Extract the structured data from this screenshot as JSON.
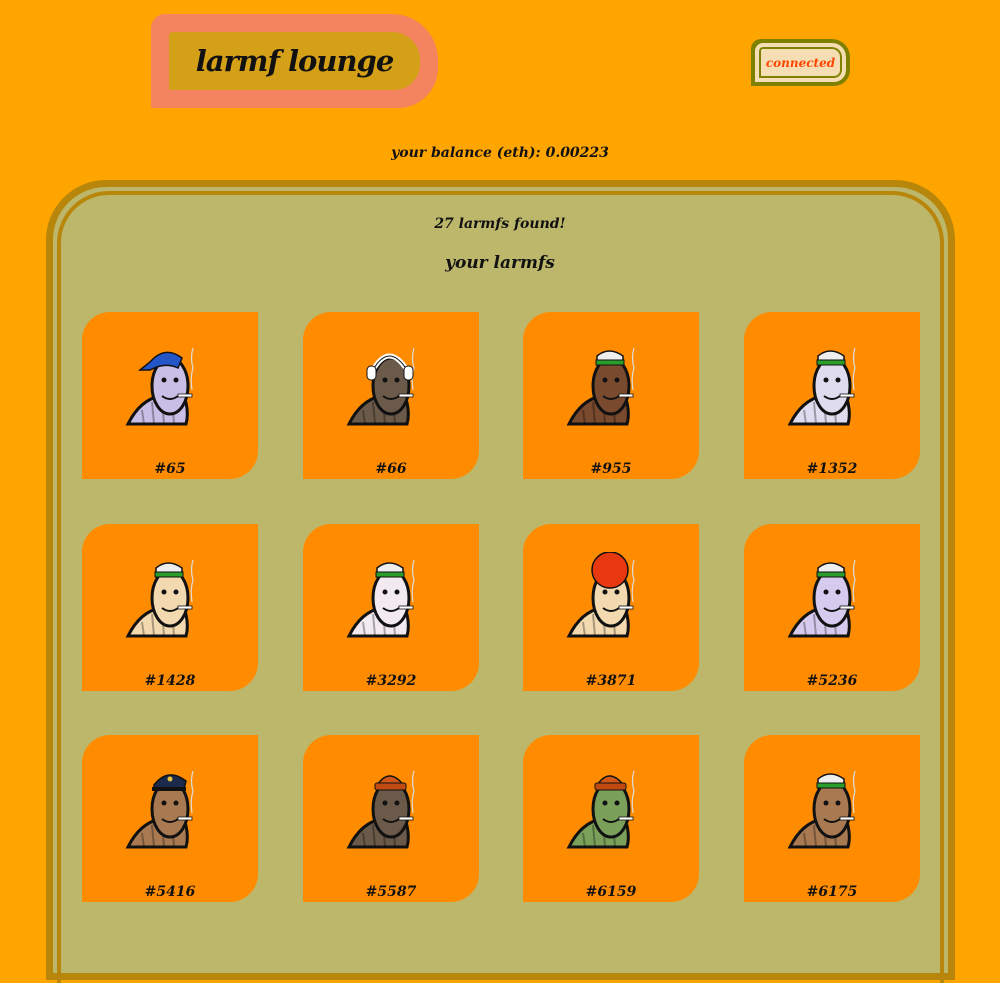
{
  "header": {
    "title": "larmf lounge",
    "connect_label": "connected"
  },
  "balance": "your balance (eth): 0.00223",
  "collection": {
    "found_text": "27 larmfs found!",
    "heading": "your larmfs",
    "items": [
      {
        "label": "#65",
        "body": "#c9bfe6",
        "hat": "blue-bandana"
      },
      {
        "label": "#66",
        "body": "#6b5a4a",
        "hat": "headphones"
      },
      {
        "label": "#955",
        "body": "#7a4a2e",
        "hat": "sweatband"
      },
      {
        "label": "#1352",
        "body": "#e0dcef",
        "hat": "sweatband"
      },
      {
        "label": "#1428",
        "body": "#f2d9b0",
        "hat": "sweatband"
      },
      {
        "label": "#3292",
        "body": "#f2eaf0",
        "hat": "sweatband"
      },
      {
        "label": "#3871",
        "body": "#f2d9b0",
        "hat": "red-afro"
      },
      {
        "label": "#5236",
        "body": "#d6cbee",
        "hat": "sweatband"
      },
      {
        "label": "#5416",
        "body": "#a97a52",
        "hat": "police-cap"
      },
      {
        "label": "#5587",
        "body": "#6b5a4a",
        "hat": "beanie"
      },
      {
        "label": "#6159",
        "body": "#7aa05a",
        "hat": "beanie"
      },
      {
        "label": "#6175",
        "body": "#a97a52",
        "hat": "sweatband"
      }
    ]
  },
  "colors": {
    "page_bg": "#ffa500",
    "panel_bg": "#bdb76b",
    "card_bg": "#ff8c00",
    "connected_text": "#ff4500"
  }
}
